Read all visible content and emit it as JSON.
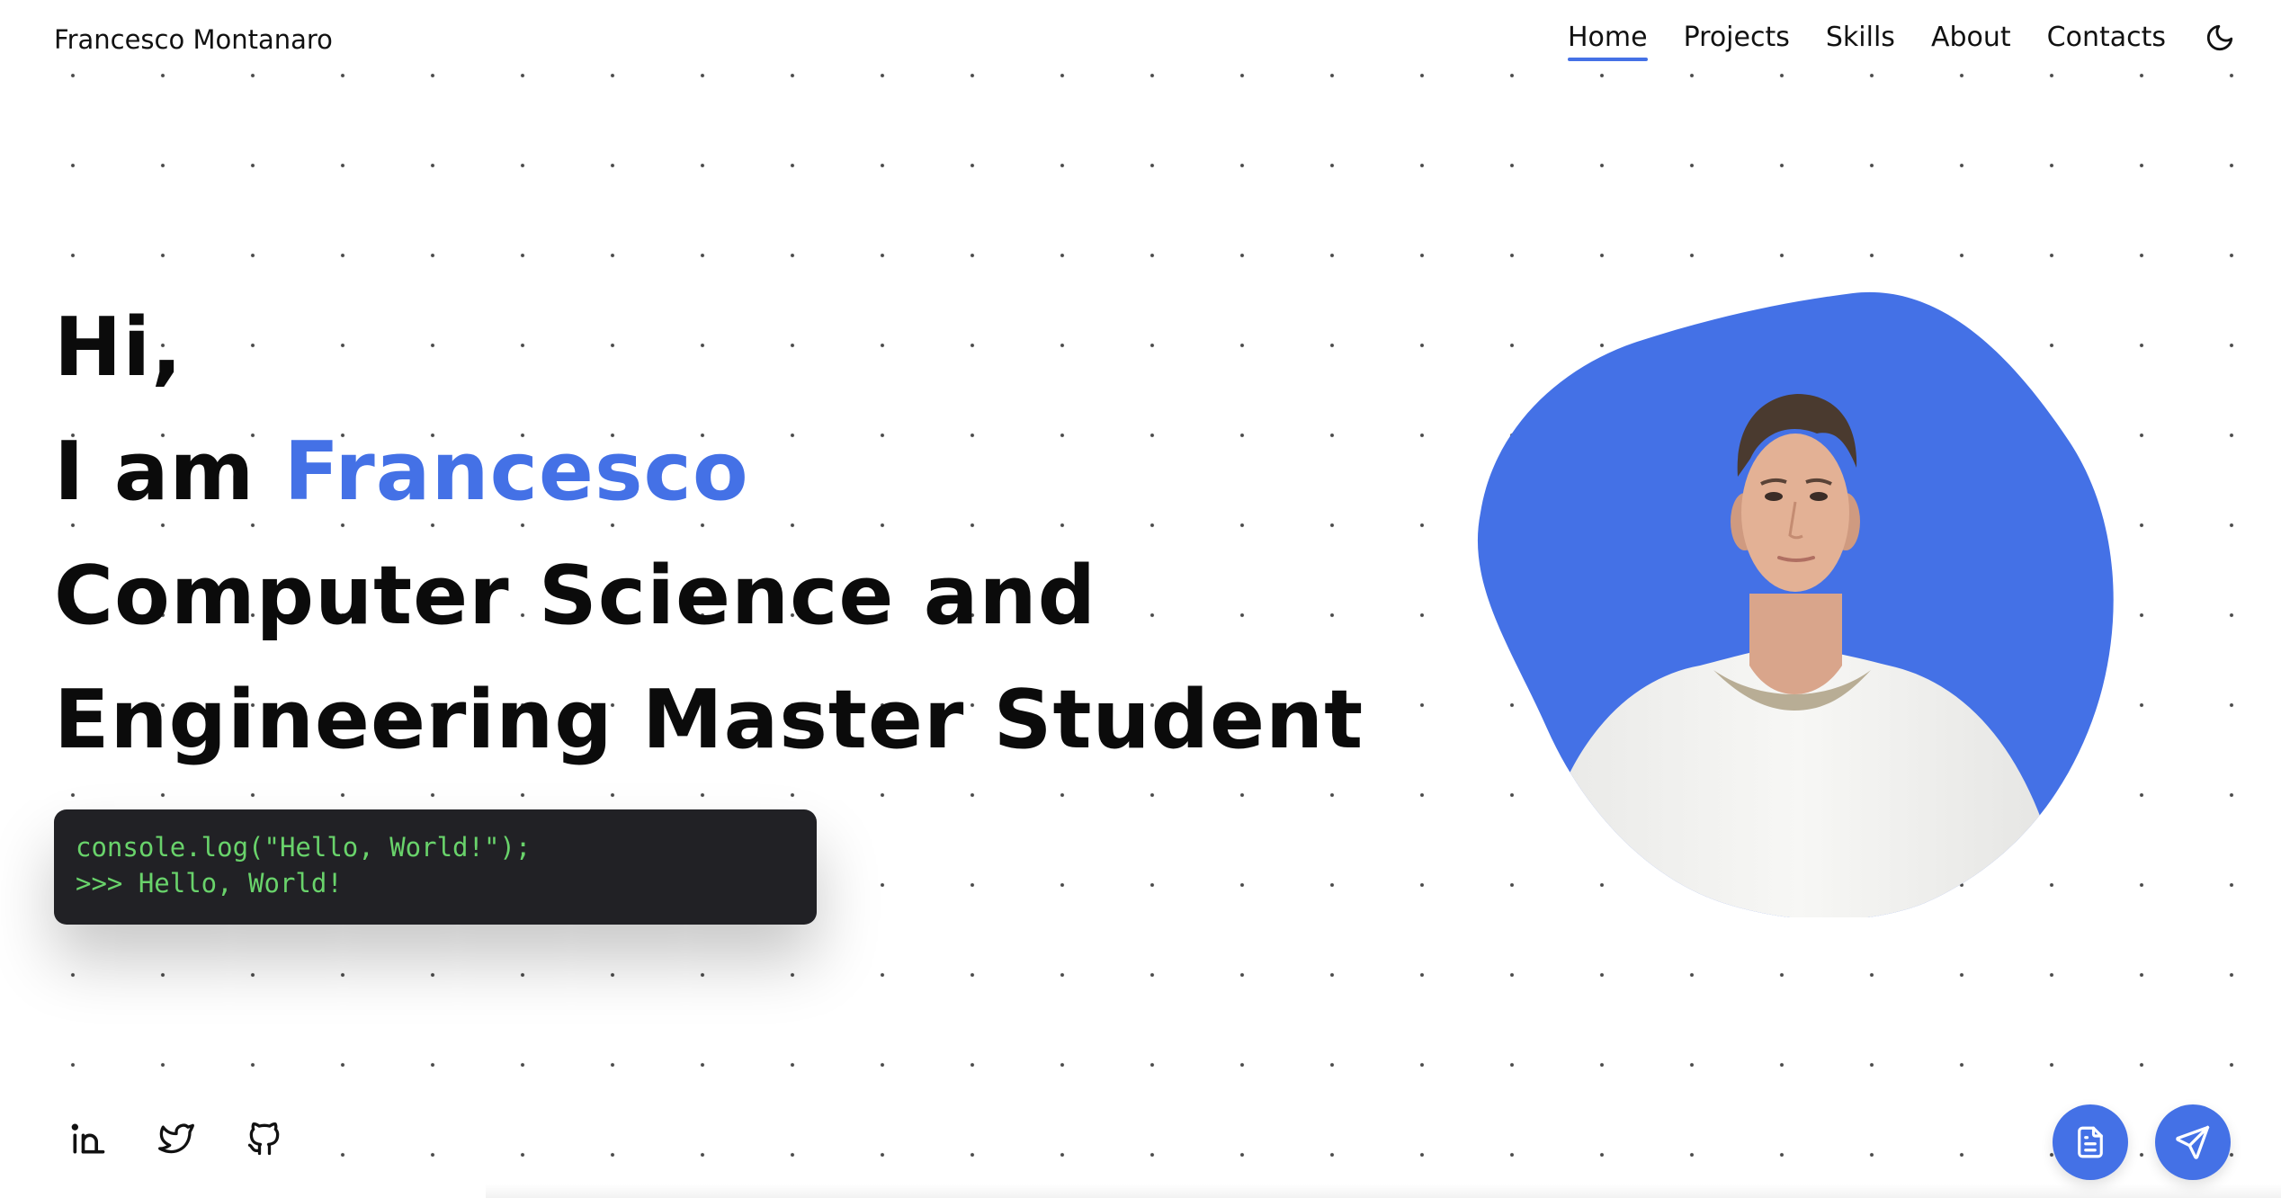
{
  "header": {
    "brand": "Francesco Montanaro",
    "nav": [
      {
        "label": "Home",
        "active": true
      },
      {
        "label": "Projects",
        "active": false
      },
      {
        "label": "Skills",
        "active": false
      },
      {
        "label": "About",
        "active": false
      },
      {
        "label": "Contacts",
        "active": false
      }
    ],
    "theme_toggle_icon": "moon-icon"
  },
  "hero": {
    "greeting": "Hi,",
    "intro_prefix": "I am ",
    "name": "Francesco",
    "role_line1": "Computer Science and",
    "role_line2": "Engineering Master Student"
  },
  "code": {
    "line1": "console.log(\"Hello, World!\");",
    "line2": ">>> Hello, World!"
  },
  "socials": [
    {
      "icon": "linkedin-icon"
    },
    {
      "icon": "twitter-icon"
    },
    {
      "icon": "github-icon"
    }
  ],
  "fabs": {
    "resume_icon": "document-icon",
    "contact_icon": "send-icon"
  },
  "colors": {
    "accent": "#4471e6",
    "code_background": "#212125",
    "code_text": "#69d36b",
    "text": "#0b0b0b"
  }
}
